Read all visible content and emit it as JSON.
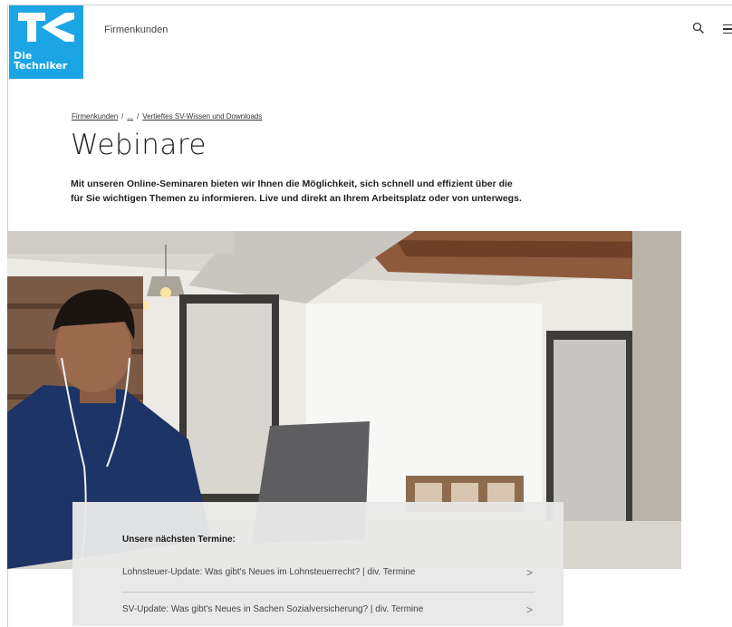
{
  "header": {
    "logo_line1": "Die",
    "logo_line2": "Techniker",
    "nav_link": "Firmenkunden"
  },
  "breadcrumb": {
    "item1": "Firmenkunden",
    "separator": "/",
    "ellipsis": "...",
    "item3": "Vertieftes SV-Wissen und Downloads"
  },
  "page": {
    "title": "Webinare",
    "intro_line1": "Mit unseren Online-Seminaren bieten wir Ihnen die Möglichkeit, sich schnell und effizient über die",
    "intro_line2": "für Sie wichtigen Themen zu informieren. Live und direkt an Ihrem Arbeitsplatz oder von unterwegs."
  },
  "termine": {
    "heading": "Unsere nächsten Termine:",
    "items": [
      {
        "label": "Lohnsteuer-Update: Was gibt's Neues im Lohnsteuerrecht? | div. Termine",
        "chevron": ">"
      },
      {
        "label": "SV-Update: Was gibt's Neues in Sachen Sozialversicherung? | div. Termine",
        "chevron": ">"
      }
    ]
  },
  "colors": {
    "brand": "#1ca5e5"
  }
}
